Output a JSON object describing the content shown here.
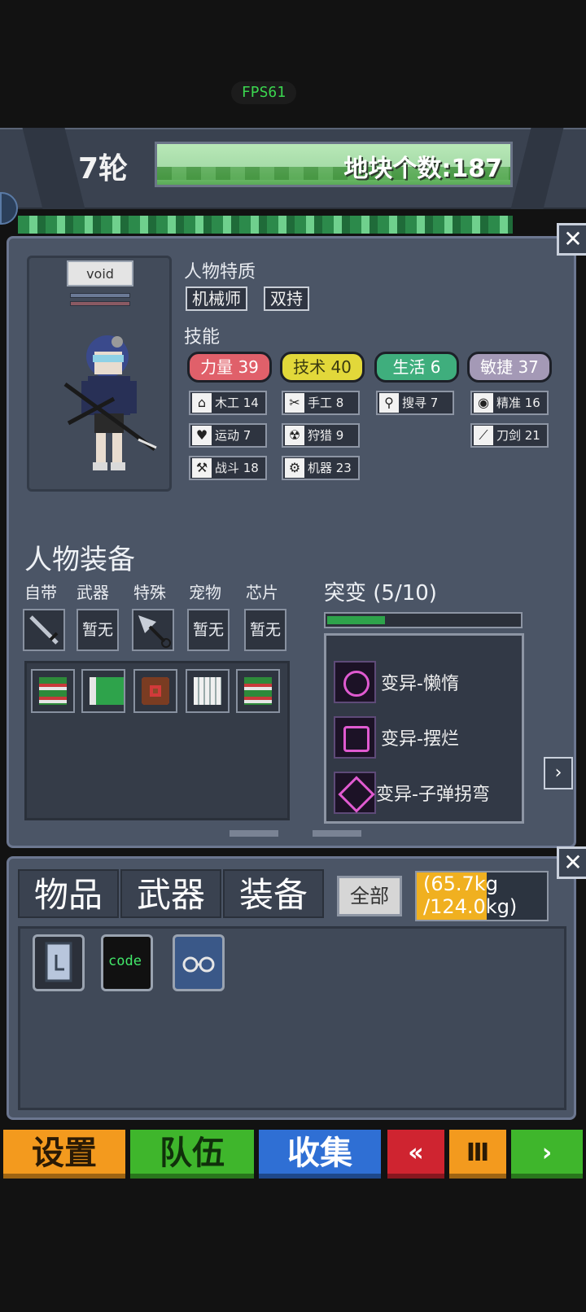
{
  "fps": "FPS61",
  "hud": {
    "round": "7轮",
    "land_count": "地块个数:187"
  },
  "character": {
    "name": "void",
    "traits_title": "人物特质",
    "traits": [
      "机械师",
      "双持"
    ],
    "skills_title": "技能",
    "attributes": [
      {
        "label": "力量 39"
      },
      {
        "label": "技术 40"
      },
      {
        "label": "生活 6"
      },
      {
        "label": "敏捷 37"
      }
    ],
    "skills": [
      {
        "icon": "house-icon",
        "glyph": "⌂",
        "label": "木工 14"
      },
      {
        "icon": "scissors-icon",
        "glyph": "✂",
        "label": "手工 8"
      },
      {
        "icon": "magnifier-icon",
        "glyph": "⚲",
        "label": "搜寻 7"
      },
      {
        "icon": "eye-icon",
        "glyph": "◉",
        "label": "精准 16"
      },
      {
        "icon": "heart-icon",
        "glyph": "♥",
        "label": "运动 7"
      },
      {
        "icon": "radiation-icon",
        "glyph": "☢",
        "label": "狩猎 9"
      },
      {
        "icon": "sword-icon",
        "glyph": "⟋",
        "label": "刀剑 21"
      },
      {
        "icon": "wrench-icon",
        "glyph": "⚒",
        "label": "战斗 18"
      },
      {
        "icon": "gear-icon",
        "glyph": "⚙",
        "label": "机器 23"
      }
    ]
  },
  "equipment": {
    "title": "人物装备",
    "slots": [
      {
        "label": "自带",
        "value": ""
      },
      {
        "label": "武器",
        "value": "暂无"
      },
      {
        "label": "特殊",
        "value": ""
      },
      {
        "label": "宠物",
        "value": "暂无"
      },
      {
        "label": "芯片",
        "value": "暂无"
      }
    ],
    "bag_icons": [
      "green-book-icon",
      "green-door-icon",
      "red-book-icon",
      "paper-grid-icon",
      "green-book-icon"
    ]
  },
  "mutation": {
    "title": "突变 (5/10)",
    "progress": 0.5,
    "items": [
      "变异-懒惰",
      "变异-摆烂",
      "变异-子弹拐弯"
    ]
  },
  "inventory": {
    "tabs": [
      "物品",
      "武器",
      "装备"
    ],
    "filter": "全部",
    "weight_top": "(65.7kg",
    "weight_bottom": "/124.0kg)",
    "items": [
      "book-icon",
      "code-chip-icon",
      "glasses-icon"
    ],
    "code_label": "code"
  },
  "bottom_bar": {
    "settings": "设置",
    "team": "队伍",
    "collect": "收集",
    "back": "«",
    "pause": "Ⅲ",
    "play": "›"
  },
  "colors": {
    "strength": "#e0606a",
    "tech": "#e2d83a",
    "life": "#3fae7d",
    "agility": "#a499b6"
  }
}
